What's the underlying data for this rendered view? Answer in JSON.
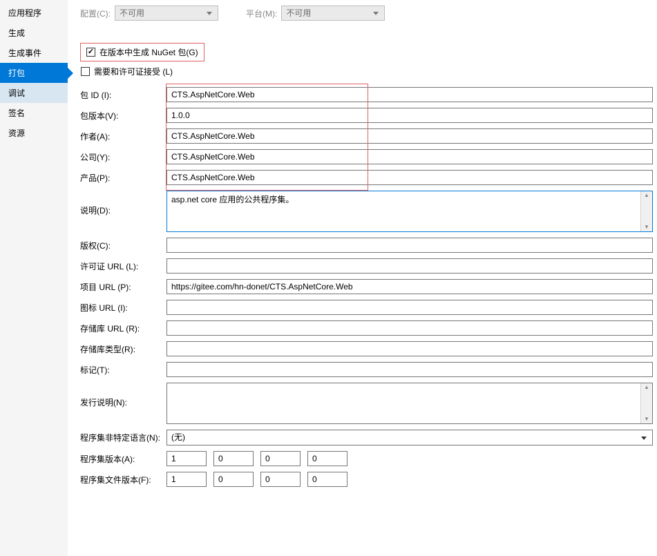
{
  "sidebar": {
    "items": [
      {
        "label": "应用程序",
        "state": ""
      },
      {
        "label": "生成",
        "state": ""
      },
      {
        "label": "生成事件",
        "state": ""
      },
      {
        "label": "打包",
        "state": "selected"
      },
      {
        "label": "调试",
        "state": "sub"
      },
      {
        "label": "签名",
        "state": ""
      },
      {
        "label": "资源",
        "state": ""
      }
    ]
  },
  "top": {
    "config_label": "配置(C):",
    "config_value": "不可用",
    "platform_label": "平台(M):",
    "platform_value": "不可用"
  },
  "checks": {
    "generate_nuget": "在版本中生成 NuGet 包(G)",
    "license_accept": "需要和许可证接受 (L)"
  },
  "form": {
    "package_id": {
      "label": "包 ID (I):",
      "value": "CTS.AspNetCore.Web"
    },
    "package_version": {
      "label": "包版本(V):",
      "value": "1.0.0"
    },
    "authors": {
      "label": "作者(A):",
      "value": "CTS.AspNetCore.Web"
    },
    "company": {
      "label": "公司(Y):",
      "value": "CTS.AspNetCore.Web"
    },
    "product": {
      "label": "产品(P):",
      "value": "CTS.AspNetCore.Web"
    },
    "description": {
      "label": "说明(D):",
      "value": "asp.net core 应用的公共程序集。"
    },
    "copyright": {
      "label": "版权(C):",
      "value": ""
    },
    "license_url": {
      "label": "许可证 URL (L):",
      "value": ""
    },
    "project_url": {
      "label": "项目 URL (P):",
      "value": "https://gitee.com/hn-donet/CTS.AspNetCore.Web"
    },
    "icon_url": {
      "label": "图标 URL (I):",
      "value": ""
    },
    "repo_url": {
      "label": "存储库 URL (R):",
      "value": ""
    },
    "repo_type": {
      "label": "存储库类型(R):",
      "value": ""
    },
    "tags": {
      "label": "标记(T):",
      "value": ""
    },
    "release_notes": {
      "label": "发行说明(N):",
      "value": ""
    },
    "neutral_lang": {
      "label": "程序集非特定语言(N):",
      "value": "(无)"
    },
    "asm_version": {
      "label": "程序集版本(A):",
      "parts": [
        "1",
        "0",
        "0",
        "0"
      ]
    },
    "file_version": {
      "label": "程序集文件版本(F):",
      "parts": [
        "1",
        "0",
        "0",
        "0"
      ]
    }
  }
}
